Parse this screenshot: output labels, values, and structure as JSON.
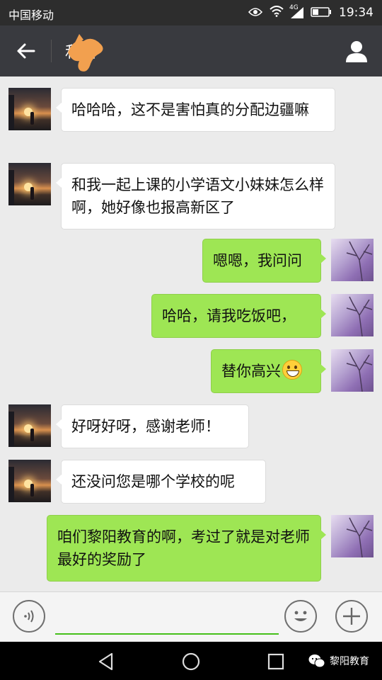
{
  "status_bar": {
    "carrier": "中国移动",
    "network": "4G",
    "time": "19:34"
  },
  "header": {
    "contact_name": "和谐"
  },
  "messages": [
    {
      "side": "left",
      "text": "哈哈哈，这不是害怕真的分配边疆嘛"
    },
    {
      "side": "left",
      "text": "和我一起上课的小学语文小妹妹怎么样啊，她好像也报高新区了"
    },
    {
      "side": "right",
      "text": "嗯嗯，我问问"
    },
    {
      "side": "right",
      "text": "哈哈，请我吃饭吧，"
    },
    {
      "side": "right",
      "text": "替你高兴"
    },
    {
      "side": "left",
      "text": "好呀好呀，感谢老师！"
    },
    {
      "side": "left",
      "text": "还没问您是哪个学校的呢"
    },
    {
      "side": "right",
      "text": "咱们黎阳教育的啊，考过了就是对老师最好的奖励了"
    }
  ],
  "input": {
    "value": "",
    "placeholder": ""
  },
  "watermark": {
    "label": "黎阳教育"
  },
  "colors": {
    "title_bar": "#393a3f",
    "status_bar": "#2d2d2d",
    "sent_bubble": "#9ee654",
    "received_bubble": "#ffffff",
    "chat_background": "#ebebeb",
    "input_underline": "#45c01a"
  }
}
